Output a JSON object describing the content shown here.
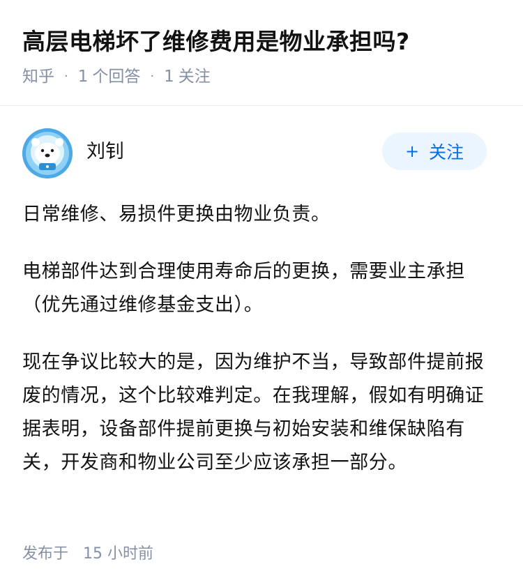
{
  "question": {
    "title": "高层电梯坏了维修费用是物业承担吗?",
    "source": "知乎",
    "answer_count": "1",
    "answer_count_label": "个回答",
    "follow_count": "1",
    "follow_count_label": "关注"
  },
  "answer": {
    "author_name": "刘钊",
    "avatar_icon": "polar-bear-astronaut-avatar",
    "follow_button_label": "关注",
    "follow_button_icon": "plus-icon",
    "paragraphs": [
      "日常维修、易损件更换由物业负责。",
      "电梯部件达到合理使用寿命后的更换，需要业主承担（优先通过维修基金支出）。",
      "现在争议比较大的是，因为维护不当，导致部件提前报废的情况，这个比较难判定。在我理解，假如有明确证据表明，设备部件提前更换与初始安装和维保缺陷有关，开发商和物业公司至少应该承担一部分。"
    ],
    "footer_prefix": "发布于",
    "footer_time": "15 小时前"
  },
  "colors": {
    "muted_text": "#8590a6",
    "accent_blue": "#056de8",
    "follow_button_bg": "#ebf5ff",
    "avatar_bg": "#4da9e6"
  }
}
